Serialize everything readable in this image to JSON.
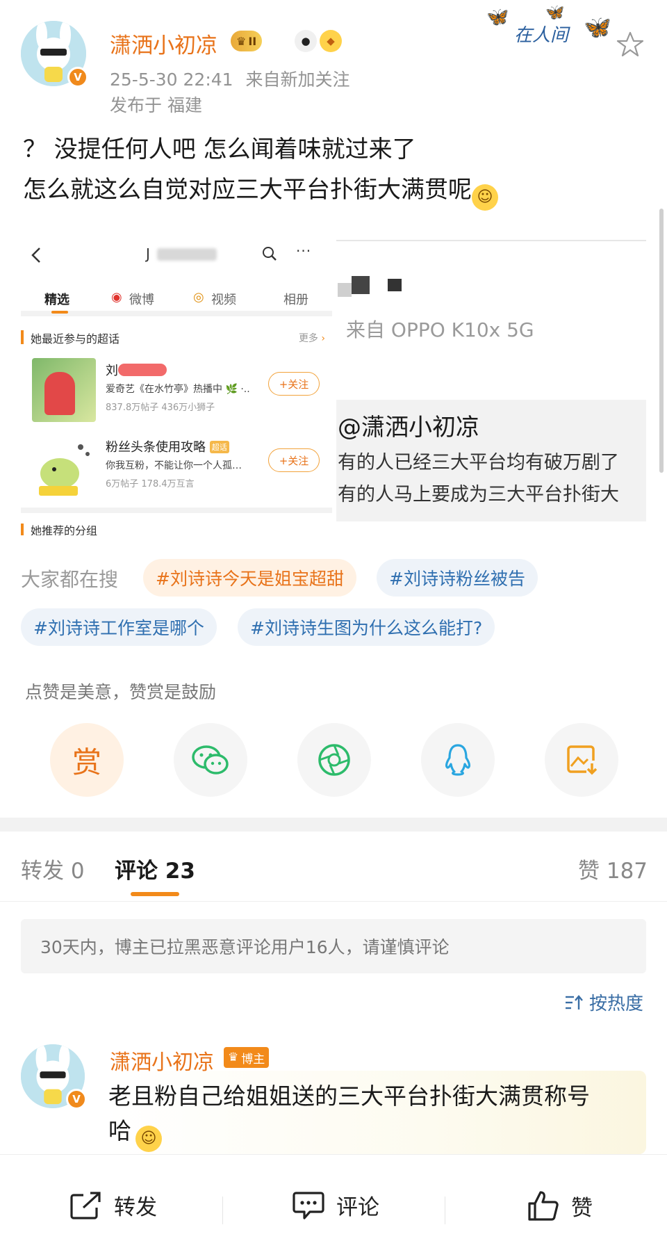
{
  "post": {
    "username": "潇洒小初凉",
    "vip_level": "II",
    "timestamp": "25-5-30 22:41",
    "source": "来自新加关注",
    "location": "发布于 福建",
    "decor_text": "在人间",
    "text_line1": "？ 没提任何人吧 怎么闻着味就过来了",
    "text_line2": "怎么就这么自觉对应三大平台扑街大满贯呢"
  },
  "embedded_shot": {
    "handle": "J",
    "tabs": [
      "精选",
      "微博",
      "视频",
      "相册"
    ],
    "section_title": "她最近参与的超话",
    "more": "更多",
    "rows": [
      {
        "title": "刘",
        "sub": "爱奇艺《在水竹亭》热播中 🌿 ·..",
        "stat": "837.8万帖子 436万小狮子",
        "follow": "+关注"
      },
      {
        "title": "粉丝头条使用攻略",
        "tag": "超话",
        "sub": "你我互粉，不能让你一个人孤…",
        "stat": "6万帖子 178.4万互言",
        "follow": "+关注"
      }
    ],
    "bottom_title": "她推荐的分组"
  },
  "right_pane": {
    "device": "来自 OPPO K10x 5G",
    "quote_name": "@潇洒小初凉",
    "quote_line1": "有的人已经三大平台均有破万剧了",
    "quote_line2": "有的人马上要成为三大平台扑街大"
  },
  "trending": {
    "label": "大家都在搜",
    "tags": [
      "#刘诗诗今天是姐宝超甜",
      "#刘诗诗粉丝被告",
      "#刘诗诗工作室是哪个",
      "#刘诗诗生图为什么这么能打?"
    ]
  },
  "reward": {
    "note": "点赞是美意，赞赏是鼓励",
    "reward_label": "赏"
  },
  "tabs": {
    "repost_label": "转发",
    "repost_count": "0",
    "comment_label": "评论",
    "comment_count": "23",
    "like_label": "赞",
    "like_count": "187"
  },
  "notice": "30天内，博主已拉黑恶意评论用户16人，请谨慎评论",
  "sort_label": "按热度",
  "comment": {
    "username": "潇洒小初凉",
    "badge": "博主",
    "text_line1": "老且粉自己给姐姐送的三大平台扑街大满贯称号",
    "text_line2": "哈"
  },
  "bottom_bar": {
    "repost": "转发",
    "comment": "评论",
    "like": "赞"
  },
  "colors": {
    "accent_orange": "#e8731a",
    "tag_blue": "#2f6fb0",
    "wechat_green": "#2dbb6b",
    "qq_blue": "#2aa6e0",
    "save_orange": "#f0a020"
  }
}
